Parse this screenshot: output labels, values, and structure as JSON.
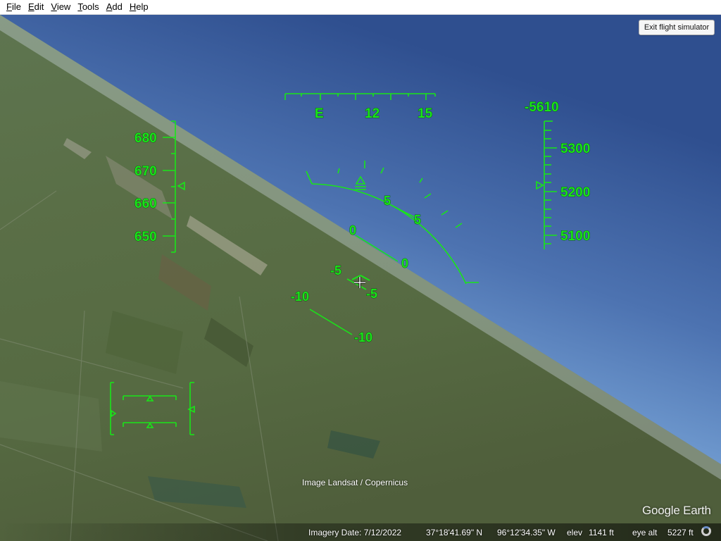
{
  "menu": {
    "items": [
      {
        "label": "File",
        "accel": "F",
        "rest": "ile"
      },
      {
        "label": "Edit",
        "accel": "E",
        "rest": "dit"
      },
      {
        "label": "View",
        "accel": "V",
        "rest": "iew"
      },
      {
        "label": "Tools",
        "accel": "T",
        "rest": "ools"
      },
      {
        "label": "Add",
        "accel": "A",
        "rest": "dd"
      },
      {
        "label": "Help",
        "accel": "H",
        "rest": "elp"
      }
    ]
  },
  "exit_button": {
    "label": "Exit flight simulator"
  },
  "hud": {
    "color": "#19e519",
    "heading": {
      "labels": [
        "E",
        "12",
        "15"
      ]
    },
    "speed": {
      "labels": [
        "680",
        "670",
        "660",
        "650"
      ]
    },
    "altitude": {
      "top_readout": "-5610",
      "labels": [
        "5300",
        "5200",
        "5100"
      ]
    },
    "pitch_ladder": {
      "left": [
        "5",
        "0",
        "-5",
        "-10"
      ],
      "right": [
        "5",
        "0",
        "-5",
        "-10"
      ]
    }
  },
  "attribution": "Image Landsat / Copernicus",
  "brand": "Google Earth",
  "status": {
    "imagery_date": "Imagery Date: 7/12/2022",
    "latitude": "37°18'41.69\" N",
    "longitude": "96°12'34.35\" W",
    "elev_label": "elev",
    "elev_value": "1141 ft",
    "eye_alt_label": "eye alt",
    "eye_alt_value": "5227 ft"
  }
}
